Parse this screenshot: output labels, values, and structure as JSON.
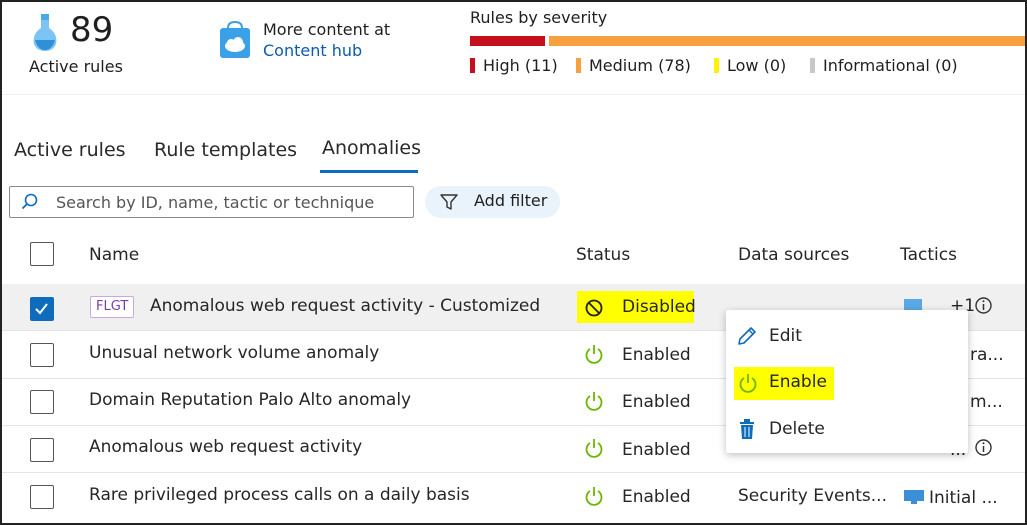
{
  "summary": {
    "active_rules_count": "89",
    "active_rules_label": "Active rules",
    "content_label": "More content at",
    "content_link": "Content hub"
  },
  "severity": {
    "title": "Rules by severity",
    "items": [
      {
        "label": "High (11)",
        "color": "#c50f1f"
      },
      {
        "label": "Medium (78)",
        "color": "#f7a040"
      },
      {
        "label": "Low (0)",
        "color": "#fff100"
      },
      {
        "label": "Informational (0)",
        "color": "#c8c8c8"
      }
    ]
  },
  "tabs": [
    {
      "label": "Active rules"
    },
    {
      "label": "Rule templates"
    },
    {
      "label": "Anomalies",
      "selected": true
    }
  ],
  "search": {
    "placeholder": "Search by ID, name, tactic or technique"
  },
  "filter": {
    "label": "Add filter"
  },
  "table": {
    "headers": [
      "Name",
      "Status",
      "Data sources",
      "Tactics"
    ],
    "rows": [
      {
        "tag": "FLGT",
        "name": "Anomalous web request activity - Customized",
        "status": "Disabled",
        "data_source": "",
        "tactic": "+1",
        "checked": true
      },
      {
        "name": "Unusual network volume anomaly",
        "status": "Enabled",
        "data_source": "",
        "tactic": "ra..."
      },
      {
        "name": "Domain Reputation Palo Alto anomaly",
        "status": "Enabled",
        "data_source": "",
        "tactic": "m..."
      },
      {
        "name": "Anomalous web request activity",
        "status": "Enabled",
        "data_source": "",
        "tactic": "..."
      },
      {
        "name": "Rare privileged process calls on a daily basis",
        "status": "Enabled",
        "data_source": "Security Events...",
        "tactic": "Initial ..."
      }
    ]
  },
  "context_menu": {
    "items": [
      {
        "label": "Edit",
        "icon": "pencil-icon"
      },
      {
        "label": "Enable",
        "icon": "power-icon"
      },
      {
        "label": "Delete",
        "icon": "trash-icon"
      }
    ]
  }
}
